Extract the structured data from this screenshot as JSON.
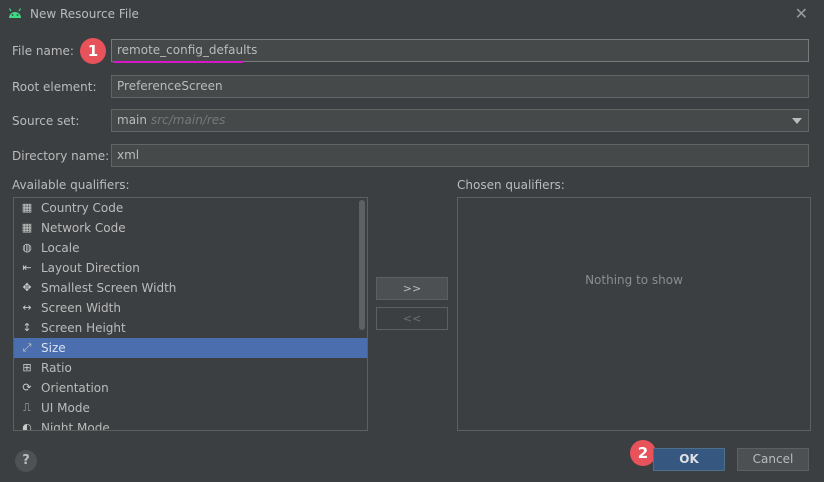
{
  "window": {
    "title": "New Resource File",
    "close_glyph": "✕"
  },
  "form": {
    "file_name_label": "File name:",
    "file_name_value": "remote_config_defaults",
    "root_element_label": "Root element:",
    "root_element_value": "PreferenceScreen",
    "source_set_label": "Source set:",
    "source_set_value": "main",
    "source_set_hint": "src/main/res",
    "directory_name_label": "Directory name:",
    "directory_name_value": "xml"
  },
  "qualifiers": {
    "available_label": "Available qualifiers:",
    "chosen_label": "Chosen qualifiers:",
    "empty_text": "Nothing to show",
    "add_label": ">>",
    "remove_label": "<<",
    "items": [
      {
        "label": "Country Code",
        "icon": "country-code-icon",
        "glyph": "▦"
      },
      {
        "label": "Network Code",
        "icon": "network-code-icon",
        "glyph": "▦"
      },
      {
        "label": "Locale",
        "icon": "globe-icon",
        "glyph": "◍"
      },
      {
        "label": "Layout Direction",
        "icon": "layout-direction-icon",
        "glyph": "⇤"
      },
      {
        "label": "Smallest Screen Width",
        "icon": "smallest-width-icon",
        "glyph": "✥"
      },
      {
        "label": "Screen Width",
        "icon": "screen-width-icon",
        "glyph": "↔"
      },
      {
        "label": "Screen Height",
        "icon": "screen-height-icon",
        "glyph": "↕"
      },
      {
        "label": "Size",
        "icon": "size-icon",
        "glyph": "⤢"
      },
      {
        "label": "Ratio",
        "icon": "ratio-icon",
        "glyph": "⊞"
      },
      {
        "label": "Orientation",
        "icon": "orientation-icon",
        "glyph": "⟳"
      },
      {
        "label": "UI Mode",
        "icon": "ui-mode-icon",
        "glyph": "⎍"
      },
      {
        "label": "Night Mode",
        "icon": "night-mode-icon",
        "glyph": "◐"
      }
    ],
    "selected_index": 7
  },
  "buttons": {
    "ok": "OK",
    "cancel": "Cancel",
    "help": "?"
  },
  "annotations": {
    "badge1": "1",
    "badge2": "2"
  },
  "colors": {
    "background": "#3c3f41",
    "selection": "#4b6eaf",
    "ok_button": "#365880",
    "badge": "#e8525a",
    "underline": "#d616c9"
  }
}
